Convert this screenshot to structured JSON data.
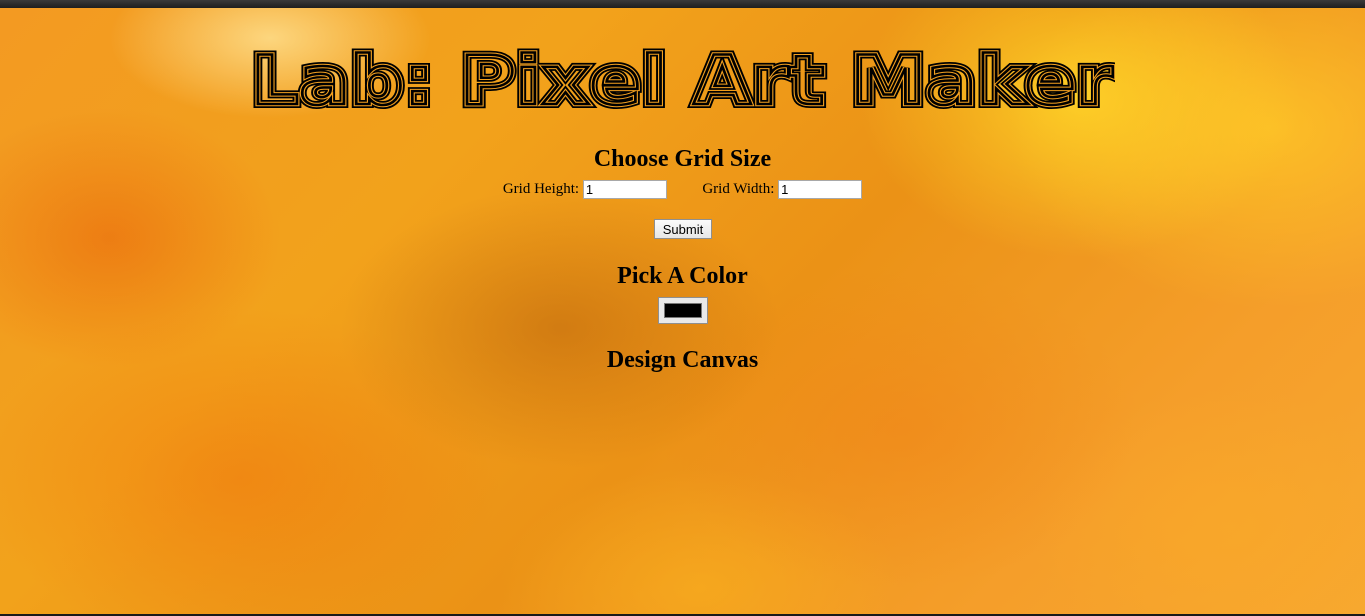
{
  "page": {
    "title": "Lab: Pixel Art Maker"
  },
  "grid_size": {
    "heading": "Choose Grid Size",
    "height_label": "Grid Height:",
    "height_value": "1",
    "width_label": "Grid Width:",
    "width_value": "1",
    "submit_label": "Submit"
  },
  "color": {
    "heading": "Pick A Color",
    "value": "#000000"
  },
  "canvas": {
    "heading": "Design Canvas"
  },
  "colors": {
    "background_accent": "#f2a21b",
    "title_stroke": "#000000"
  }
}
